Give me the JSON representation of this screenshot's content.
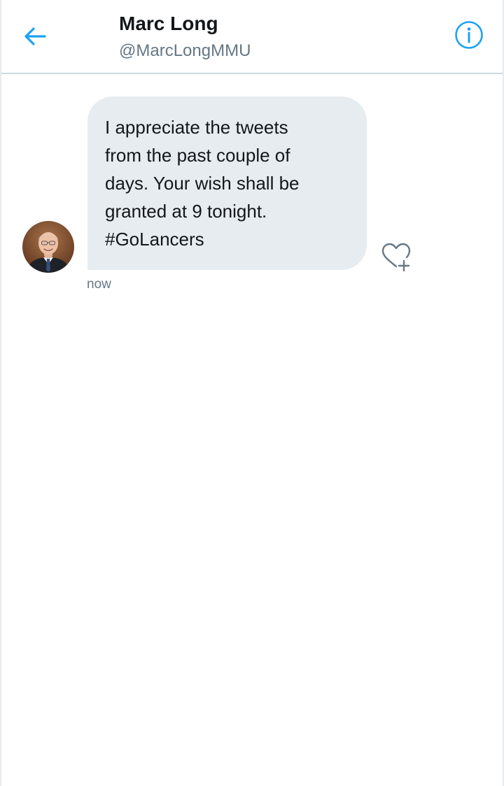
{
  "header": {
    "back_icon": "arrow-left-icon",
    "name": "Marc Long",
    "handle": "@MarcLongMMU",
    "info_icon": "info-icon"
  },
  "message": {
    "text": "I appreciate the tweets\nfrom the past couple of\ndays. Your wish shall be\ngranted at 9 tonight.\n#GoLancers",
    "timestamp": "now",
    "like_icon": "heart-plus-icon"
  },
  "colors": {
    "accent": "#1da1f2",
    "bubble": "#e6ecf0",
    "secondary_text": "#657786",
    "divider": "#ccd6dd"
  }
}
